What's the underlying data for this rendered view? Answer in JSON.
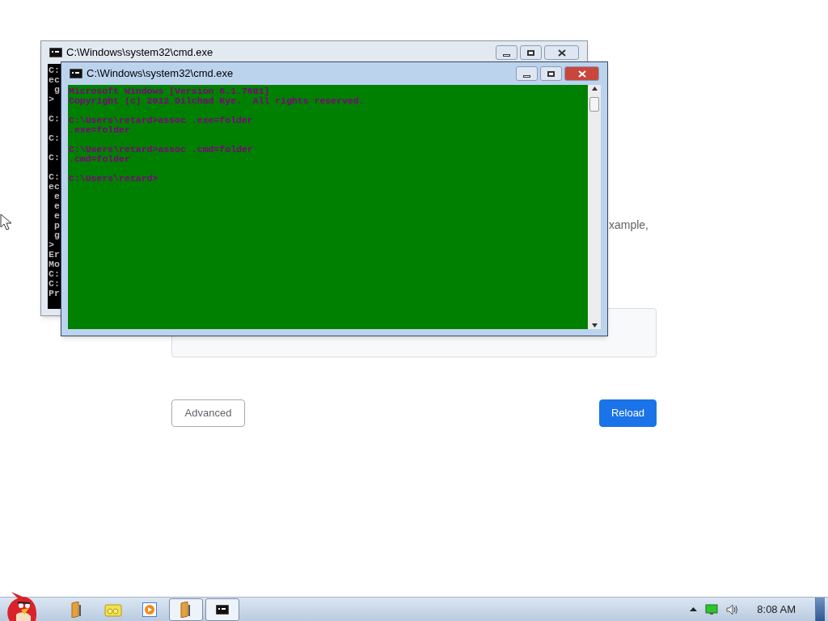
{
  "background_page": {
    "partial_text": "xample,",
    "buttons": [
      {
        "label": "Advanced",
        "kind": "secondary"
      },
      {
        "label": "Reload",
        "kind": "primary"
      }
    ]
  },
  "windows": [
    {
      "title": "C:\\Windows\\system32\\cmd.exe",
      "active": false,
      "blocks": [
        [
          "C:",
          "ec",
          " g",
          ">"
        ],
        [
          "C:"
        ],
        [
          "C:"
        ],
        [
          "C:"
        ],
        [
          "C:",
          "ec",
          " e",
          " e",
          " e",
          " p",
          " g",
          ">",
          "Er",
          "Mo",
          "C:",
          "C:",
          "Pr"
        ]
      ]
    },
    {
      "title": "C:\\Windows\\system32\\cmd.exe",
      "active": true,
      "blocks": [
        [
          "Microsoft Windows [Version 6.1.7601]",
          "Copyright (c) 2012 Dilchad Kye.  All rights reserved."
        ],
        [
          "C:\\Users\\retard>assoc .exe=folder",
          ".exe=folder"
        ],
        [
          "C:\\Users\\retard>assoc .cmd=folder",
          ".cmd=folder"
        ],
        [
          "C:\\Users\\retard>"
        ]
      ]
    }
  ],
  "taskbar": {
    "items": [
      {
        "kind": "folder",
        "open": false
      },
      {
        "kind": "library",
        "open": false
      },
      {
        "kind": "media",
        "open": false
      },
      {
        "kind": "folder",
        "open": true
      },
      {
        "kind": "console",
        "open": true
      }
    ],
    "clock": "8:08 AM"
  }
}
